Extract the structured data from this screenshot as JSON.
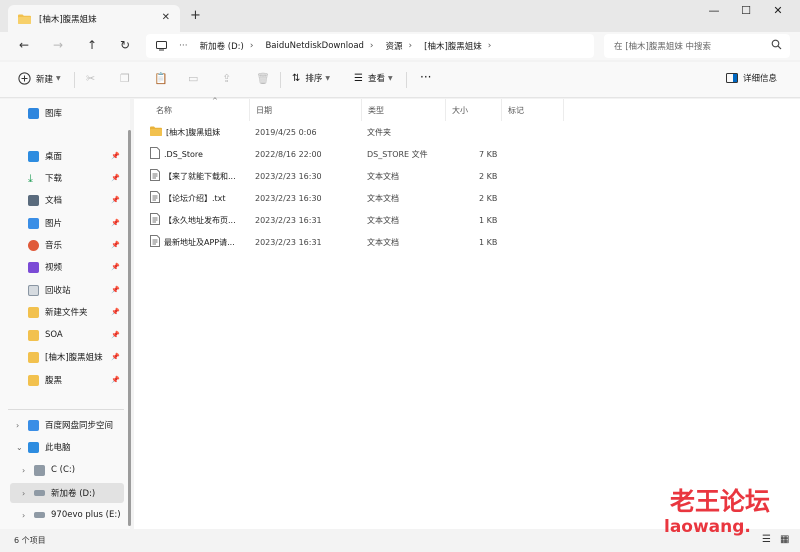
{
  "tab": {
    "title": "[柚木]腹黑姐妹"
  },
  "address": {
    "crumbs": [
      "新加卷 (D:)",
      "BaiduNetdiskDownload",
      "资源",
      "[柚木]腹黑姐妹"
    ],
    "more": "···"
  },
  "search": {
    "placeholder": "在 [柚木]腹黑姐妹 中搜索"
  },
  "toolbar": {
    "new_label": "新建",
    "sort_label": "排序",
    "view_label": "查看",
    "more_label": "···",
    "details_label": "详细信息"
  },
  "sidebar": {
    "gallery": "图库",
    "pinned": [
      "桌面",
      "下载",
      "文档",
      "图片",
      "音乐",
      "视频",
      "回收站",
      "新建文件夹",
      "SOA",
      "[柚木]腹黑姐妹",
      "腹黑"
    ],
    "baidu": "百度网盘同步空间",
    "this_pc": "此电脑",
    "drives": [
      "C (C:)",
      "新加卷 (D:)",
      "970evo plus (E:)"
    ]
  },
  "columns": {
    "name": "名称",
    "date": "日期",
    "type": "类型",
    "size": "大小",
    "tags": "标记"
  },
  "files": [
    {
      "name": "[柚木]腹黑姐妹",
      "date": "2019/4/25 0:06",
      "type": "文件夹",
      "size": "",
      "kind": "folder"
    },
    {
      "name": ".DS_Store",
      "date": "2022/8/16 22:00",
      "type": "DS_STORE 文件",
      "size": "7 KB",
      "kind": "file"
    },
    {
      "name": "【来了就能下载和...",
      "date": "2023/2/23 16:30",
      "type": "文本文档",
      "size": "2 KB",
      "kind": "text"
    },
    {
      "name": "【论坛介绍】.txt",
      "date": "2023/2/23 16:30",
      "type": "文本文档",
      "size": "2 KB",
      "kind": "text"
    },
    {
      "name": "【永久地址发布页...",
      "date": "2023/2/23 16:31",
      "type": "文本文档",
      "size": "1 KB",
      "kind": "text"
    },
    {
      "name": "最新地址及APP请...",
      "date": "2023/2/23 16:31",
      "type": "文本文档",
      "size": "1 KB",
      "kind": "text"
    }
  ],
  "status": {
    "count": "6 个项目"
  },
  "watermark": {
    "line1": "老王论坛",
    "line2": "laowang."
  },
  "colors": {
    "folder": "#f2c14e",
    "accent": "#0067c0",
    "watermark": "#e8262f"
  }
}
